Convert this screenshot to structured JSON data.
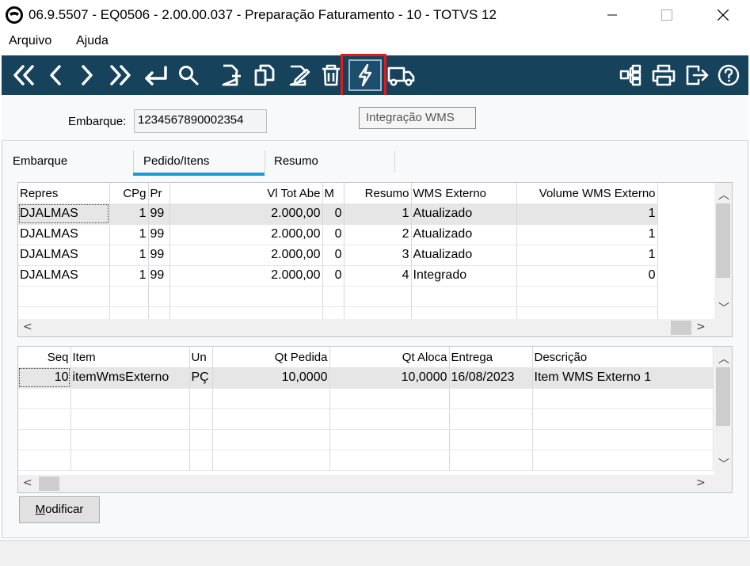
{
  "window": {
    "title": "06.9.5507 - EQ0506 - 2.00.00.037 - Preparação Faturamento - 10 - TOTVS 12"
  },
  "menu": [
    "Arquivo",
    "Ajuda"
  ],
  "toolbar": {
    "background": "#16425c",
    "highlight_color": "#e01b1b",
    "buttons": [
      "first-icon",
      "previous-icon",
      "next-icon",
      "last-icon",
      "return-icon",
      "search-icon",
      "new-doc-icon",
      "copy-icon",
      "edit-icon",
      "delete-icon",
      "lightning-icon",
      "truck-icon",
      "tree-icon",
      "print-icon",
      "exit-icon",
      "help-icon"
    ]
  },
  "tooltip": "Integração WMS",
  "header": {
    "embarque_label": "Embarque:",
    "embarque_value": "1234567890002354"
  },
  "tabs": [
    "Embarque",
    "Pedido/Itens",
    "Resumo"
  ],
  "active_tab_color": "#1c9ad6",
  "pedidos": {
    "columns": [
      "Repres",
      "CPg",
      "Pr",
      "Vl Tot Abe",
      "M",
      "Resumo",
      "WMS Externo",
      "Volume WMS Externo"
    ],
    "rows": [
      [
        "DJALMAS",
        "1",
        "99",
        "2.000,00",
        "0",
        "1",
        "Atualizado",
        "1"
      ],
      [
        "DJALMAS",
        "1",
        "99",
        "2.000,00",
        "0",
        "2",
        "Atualizado",
        "1"
      ],
      [
        "DJALMAS",
        "1",
        "99",
        "2.000,00",
        "0",
        "3",
        "Atualizado",
        "1"
      ],
      [
        "DJALMAS",
        "1",
        "99",
        "2.000,00",
        "0",
        "4",
        "Integrado",
        "0"
      ]
    ]
  },
  "itens": {
    "columns": [
      "Seq",
      "Item",
      "Un",
      "Qt Pedida",
      "Qt Aloca",
      "Entrega",
      "Descrição"
    ],
    "rows": [
      [
        "10",
        "itemWmsExterno",
        "PÇ",
        "10,0000",
        "10,0000",
        "16/08/2023",
        "Item WMS Externo 1"
      ]
    ]
  },
  "buttons": {
    "modificar_first": "M",
    "modificar_rest": "odificar"
  }
}
